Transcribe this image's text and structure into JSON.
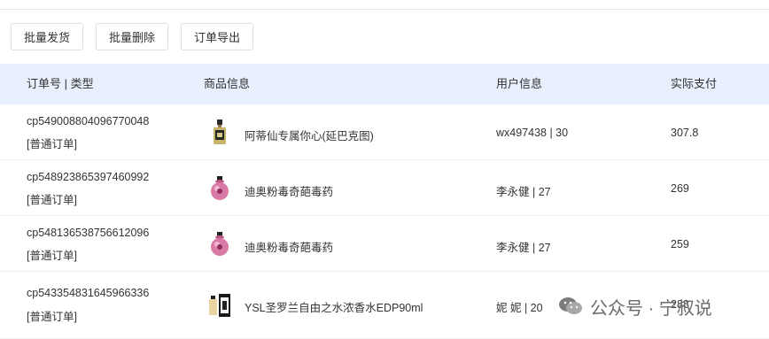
{
  "toolbar": {
    "buttons": [
      "批量发货",
      "批量删除",
      "订单导出"
    ]
  },
  "table": {
    "headers": {
      "order": "订单号 | 类型",
      "goods": "商品信息",
      "user": "用户信息",
      "pay": "实际支付"
    },
    "rows": [
      {
        "order_no": "cp549008804096770048",
        "order_type": "[普通订单]",
        "goods_icon": "perfume-bottle-gold-icon",
        "goods_name": "阿蒂仙专属你心(延巴克图)",
        "user": "wx497438 | 30",
        "pay": "307.8"
      },
      {
        "order_no": "cp548923865397460992",
        "order_type": "[普通订单]",
        "goods_icon": "perfume-bottle-pink-icon",
        "goods_name": "迪奥粉毒奇葩毒药",
        "user": "李永健 | 27",
        "pay": "269"
      },
      {
        "order_no": "cp548136538756612096",
        "order_type": "[普通订单]",
        "goods_icon": "perfume-bottle-pink-icon",
        "goods_name": "迪奥粉毒奇葩毒药",
        "user": "李永健 | 27",
        "pay": "259"
      },
      {
        "order_no": "cp543354831645966336",
        "order_type": "[普通订单]",
        "goods_icon": "perfume-box-ysl-icon",
        "goods_name": "YSL圣罗兰自由之水浓香水EDP90ml",
        "user": "妮 妮 | 20",
        "pay": "288"
      }
    ]
  },
  "watermark": {
    "text": "公众号 · 宁叔说",
    "icon": "wechat-icon"
  },
  "colors": {
    "header_bg": "#e8f0fd",
    "border": "#dcdfe6",
    "text": "#333333"
  }
}
